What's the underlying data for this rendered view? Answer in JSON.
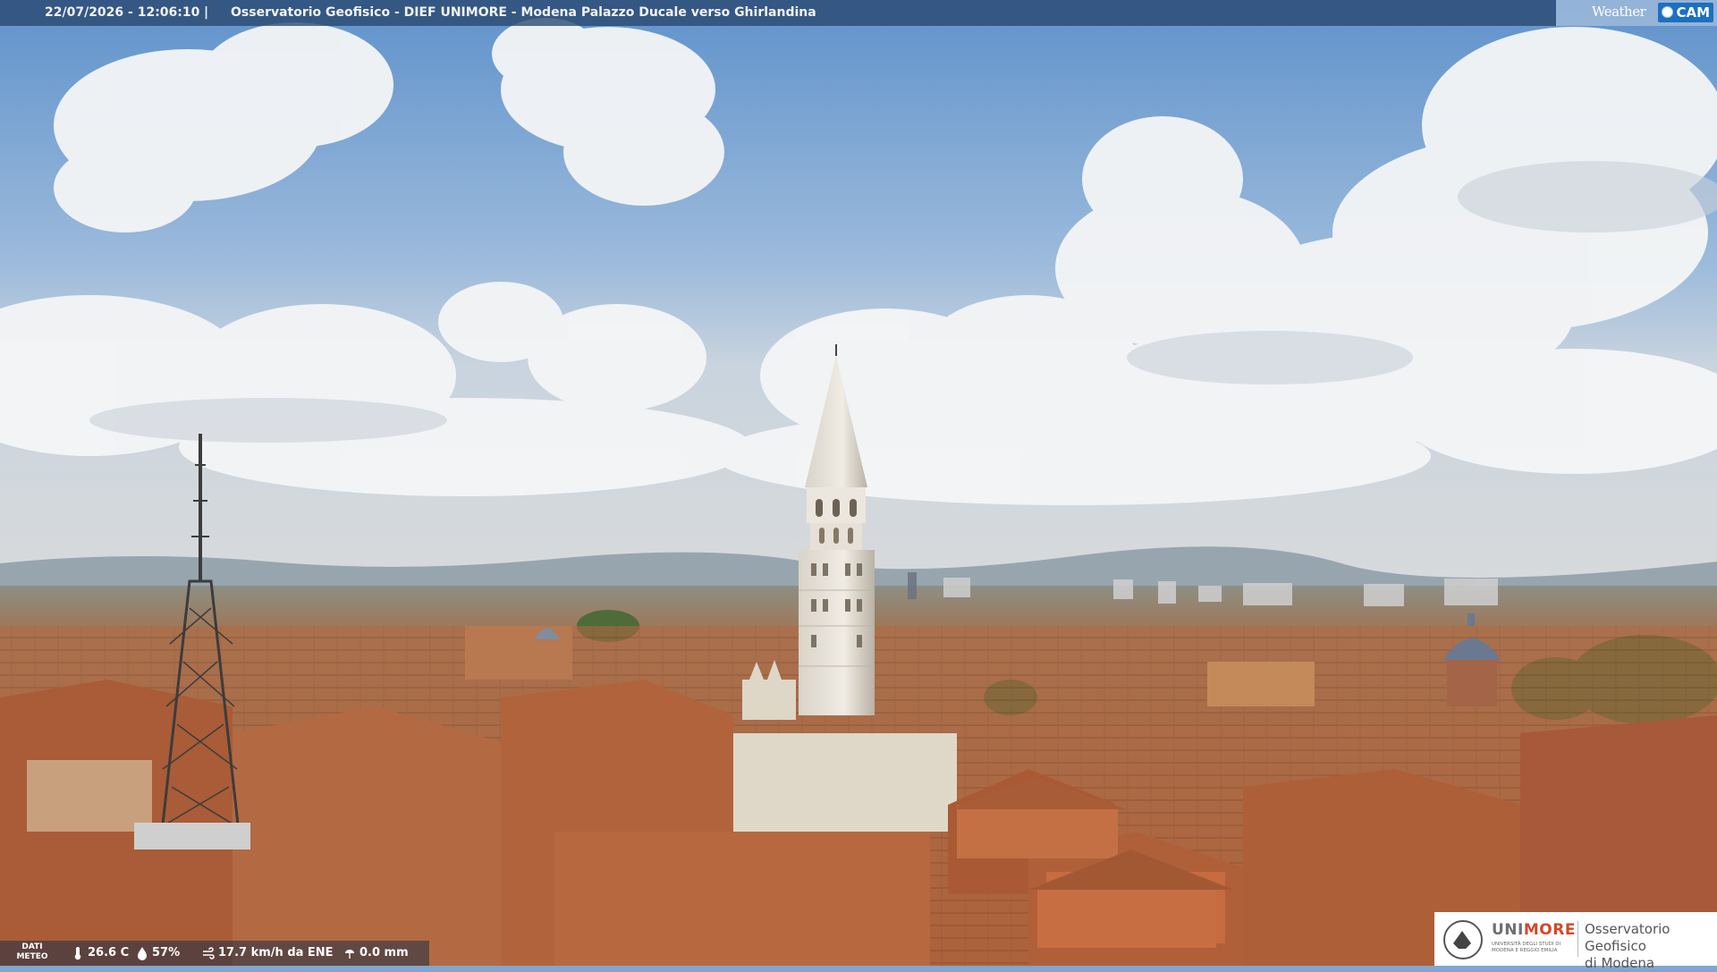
{
  "overlay": {
    "timestamp": "22/07/2026 - 12:06:10",
    "separator": "|",
    "caption": "Osservatorio Geofisico - DIEF UNIMORE - Modena Palazzo Ducale verso Ghirlandina"
  },
  "brand": {
    "weather_text": "Weather",
    "cam_text": "CAM"
  },
  "meteo": {
    "label_line1": "DATI",
    "label_line2": "METEO",
    "temperature": "26.6 C",
    "humidity": "57%",
    "wind": "17.7 km/h da ENE",
    "rain": "0.0 mm",
    "icons": [
      "thermometer-icon",
      "humidity-drop-icon",
      "wind-icon",
      "rain-icon"
    ]
  },
  "institution": {
    "brand_prefix": "UNI",
    "brand_accent": "MORE",
    "subtitle": "UNIVERSITÀ DEGLI STUDI DI MODENA E REGGIO EMILIA",
    "name_line1": "Osservatorio Geofisico",
    "name_line2": "di Modena"
  },
  "colors": {
    "sky_top": "#6d9cd0",
    "roof_terracotta": "#b0623c",
    "unimore_accent": "#d4472a",
    "weathercam_blue": "#1e6fc0"
  }
}
